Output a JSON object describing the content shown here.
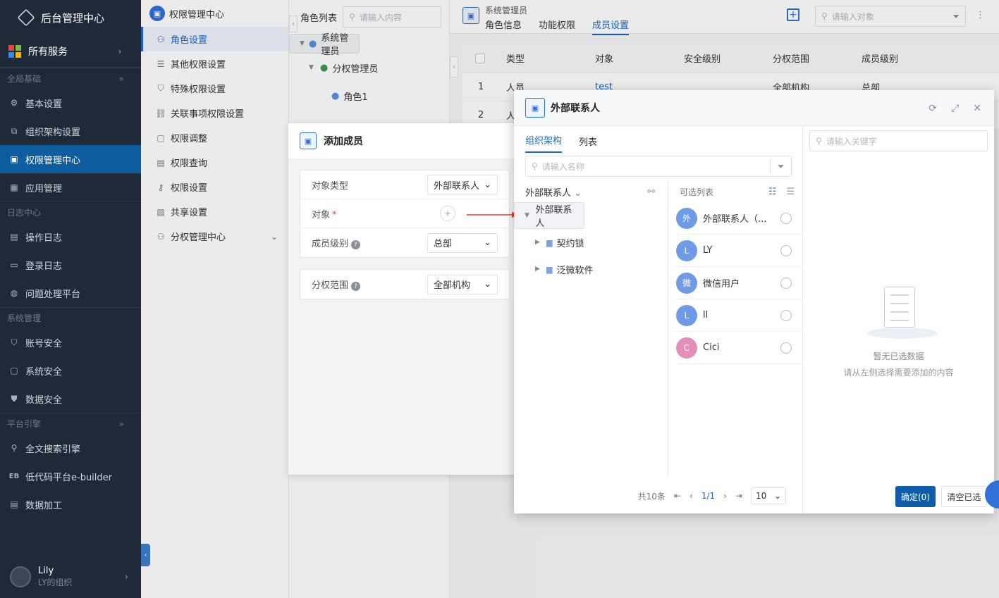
{
  "nav": {
    "brand": "后台管理中心",
    "all_services": "所有服务",
    "sections": [
      {
        "title": "全局基础",
        "items": [
          "基本设置",
          "组织架构设置",
          "权限管理中心",
          "应用管理"
        ]
      },
      {
        "title": "日志中心",
        "items": [
          "操作日志",
          "登录日志",
          "问题处理平台"
        ]
      },
      {
        "title": "系统管理",
        "items": [
          "账号安全",
          "系统安全",
          "数据安全"
        ]
      },
      {
        "title": "平台引擎",
        "items": [
          "全文搜索引擎",
          "低代码平台e-builder",
          "数据加工"
        ]
      }
    ],
    "active_item": "权限管理中心",
    "eb_prefix": "EB",
    "user": {
      "name": "Lily",
      "org": "LY的组织"
    }
  },
  "subnav": {
    "title": "权限管理中心",
    "items": [
      "角色设置",
      "其他权限设置",
      "特殊权限设置",
      "关联事项权限设置",
      "权限调整",
      "权限查询",
      "权限设置",
      "共享设置",
      "分权管理中心"
    ]
  },
  "rolepane": {
    "label": "角色列表",
    "search_placeholder": "请输入内容",
    "tree": [
      "系统管理员",
      "分权管理员",
      "角色1"
    ]
  },
  "main": {
    "crumb": "系统管理员",
    "tabs": [
      "角色信息",
      "功能权限",
      "成员设置"
    ],
    "active_tab": "成员设置",
    "search_placeholder": "请输入对象",
    "columns": [
      "类型",
      "对象",
      "安全级别",
      "分权范围",
      "成员级别"
    ],
    "rows": [
      {
        "no": "1",
        "type": "人员",
        "obj": "test",
        "scope": "全部机构",
        "level": "总部"
      },
      {
        "no": "2",
        "type": "人"
      }
    ]
  },
  "addmember": {
    "title": "添加成员",
    "fields": {
      "type_label": "对象类型",
      "type_value": "外部联系人",
      "obj_label": "对象",
      "level_label": "成员级别",
      "level_value": "总部",
      "scope_label": "分权范围",
      "scope_value": "全部机构"
    }
  },
  "extmodal": {
    "title": "外部联系人",
    "tabs": [
      "组织架构",
      "列表"
    ],
    "name_placeholder": "请输入名称",
    "tree_head": "外部联系人",
    "tree": [
      "外部联系人",
      "契约锁",
      "泛微软件"
    ],
    "avail_title": "可选列表",
    "people": [
      {
        "initial": "外",
        "name": "外部联系人（...",
        "color": "#6f9be6"
      },
      {
        "initial": "L",
        "name": "LY",
        "color": "#6f9be6"
      },
      {
        "initial": "微",
        "name": "微信用户",
        "color": "#6f9be6"
      },
      {
        "initial": "L",
        "name": "ll",
        "color": "#6f9be6"
      },
      {
        "initial": "C",
        "name": "Cici",
        "color": "#e38fb9"
      }
    ],
    "pager": {
      "total": "共10条",
      "page": "1/1",
      "size": "10"
    },
    "kw_placeholder": "请输入关键字",
    "empty_title": "暂无已选数据",
    "empty_hint": "请从左侧选择需要添加的内容",
    "ok": "确定(0)",
    "clear": "清空已选"
  },
  "colors": {
    "accent": "#1c66c4",
    "nav_bg": "#1f2a38",
    "nav_active": "#0f5c9e",
    "ok_btn": "#0f5ca8"
  }
}
